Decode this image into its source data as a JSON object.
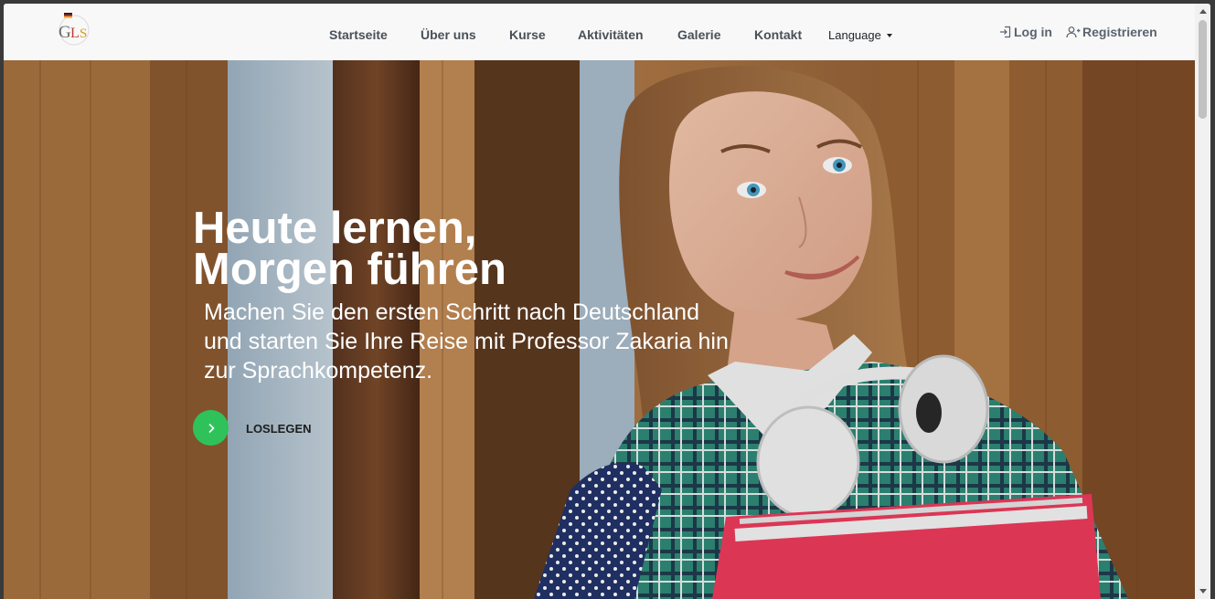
{
  "nav": {
    "logo_text": "GLS",
    "links": [
      "Startseite",
      "Über uns",
      "Kurse",
      "Aktivitäten",
      "Galerie",
      "Kontakt"
    ],
    "language_label": "Language",
    "login_label": "Log in",
    "register_label": "Registrieren"
  },
  "hero": {
    "title_line1": "Heute lernen,",
    "title_line2": "Morgen führen",
    "subtitle": "Machen Sie den ersten Schritt nach Deutschland und starten Sie Ihre Reise mit Professor Zakaria hin zur Sprachkompetenz.",
    "cta_label": "LOSLEGEN"
  },
  "colors": {
    "cta_green": "#2fc25b",
    "nav_bg": "#f8f8f8",
    "nav_text": "#495057"
  },
  "icons": {
    "login": "login-icon",
    "register": "add-user-icon",
    "cta": "chevron-right-icon",
    "language": "caret-down-icon"
  }
}
